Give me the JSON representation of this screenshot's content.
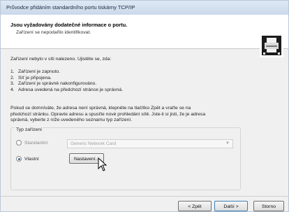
{
  "window": {
    "title": "Průvodce přidáním standardního portu tiskárny TCP/IP"
  },
  "header": {
    "title": "Jsou vyžadovány dodatečné informace o portu.",
    "subtitle": "Zařízení se nepodařilo identifikovat.",
    "icon": "printer-network-icon"
  },
  "body": {
    "intro": "Zařízení nebylo v síti nalezeno. Ujistěte se, zda:",
    "checklist": [
      {
        "num": "1.",
        "text": "Zařízení je zapnuto."
      },
      {
        "num": "2.",
        "text": "Síť je připojena."
      },
      {
        "num": "3.",
        "text": "Zařízení je správně nakonfigurováno."
      },
      {
        "num": "4.",
        "text": "Adresa uvedená na předchozí stránce je správná."
      }
    ],
    "paragraph_line1": "Pokud se domníváte, že adresa není správná, klepněte na tlačítko Zpět a vraťte se na",
    "paragraph_line2": "předchozí stránku. Opravte adresu a spusťte nové prohledání sítě. Jste-li si jisti, že je adresa",
    "paragraph_line3": "správná, vyberte z níže uvedeného seznamu typ zařízení."
  },
  "device_type": {
    "group_label": "Typ zařízení",
    "standard_label": "Standardní",
    "standard_selected": false,
    "standard_select_value": "Generic Network Card",
    "custom_label": "Vlastní",
    "custom_selected": true,
    "settings_button": "Nastavení..."
  },
  "footer": {
    "back_button": "< Zpět",
    "next_button": "Další >",
    "cancel_button": "Storno"
  }
}
